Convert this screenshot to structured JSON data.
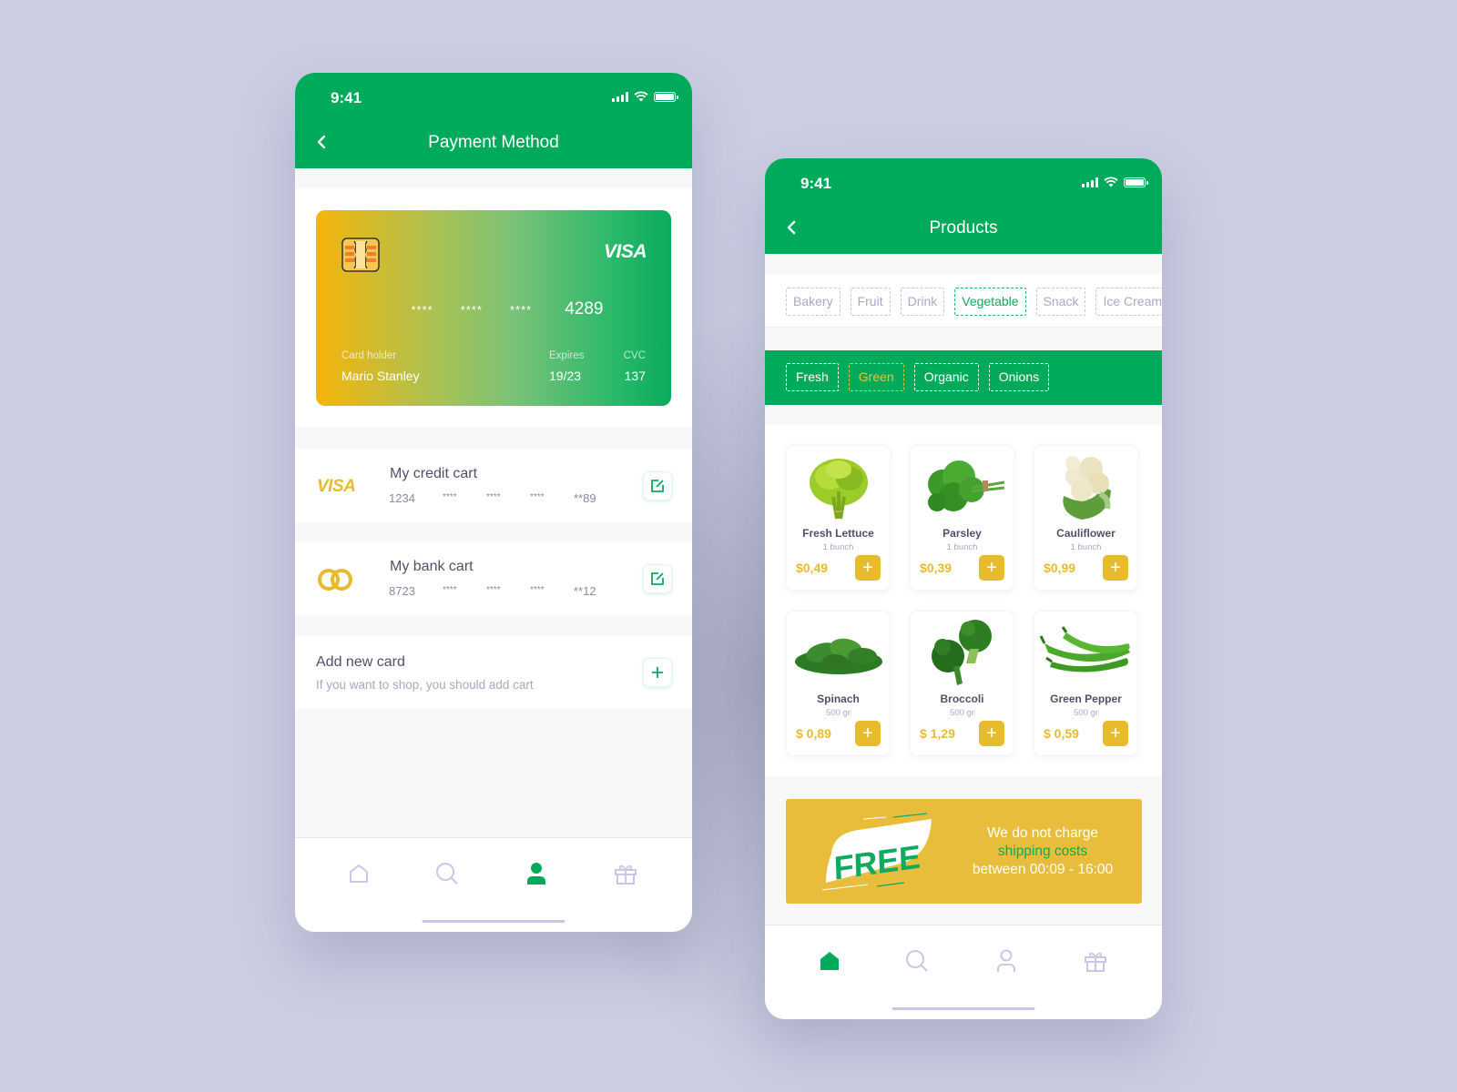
{
  "status_time": "9:41",
  "colors": {
    "brand_green": "#00aa5b",
    "accent_yellow": "#e8bb2f",
    "muted_text": "#a6a8c0",
    "inactive_icon": "#c8c8e6"
  },
  "payment": {
    "title": "Payment Method",
    "back_icon": "chevron-left-icon",
    "card": {
      "brand": "VISA",
      "number_masked": [
        "****",
        "****",
        "****"
      ],
      "last4": "4289",
      "holder_label": "Card holder",
      "holder_name": "Mario Stanley",
      "expires_label": "Expires",
      "expires_value": "19/23",
      "cvc_label": "CVC",
      "cvc_value": "137"
    },
    "saved_cards": [
      {
        "logo": "VISA",
        "title": "My credit cart",
        "digits": [
          "1234",
          "****",
          "****",
          "****",
          "**89"
        ]
      },
      {
        "logo": "mastercard-rings-icon",
        "title": "My bank cart",
        "digits": [
          "8723",
          "****",
          "****",
          "****",
          "**12"
        ]
      }
    ],
    "add_card": {
      "title": "Add new card",
      "subtitle": "If you want to shop, you should add cart"
    },
    "tabbar": {
      "active": "profile",
      "items": [
        "home",
        "search",
        "profile",
        "gift"
      ]
    }
  },
  "products": {
    "title": "Products",
    "categories": [
      {
        "label": "Bakery",
        "active": false
      },
      {
        "label": "Fruit",
        "active": false
      },
      {
        "label": "Drink",
        "active": false
      },
      {
        "label": "Vegetable",
        "active": true
      },
      {
        "label": "Snack",
        "active": false
      },
      {
        "label": "Ice Cream",
        "active": false
      }
    ],
    "subcategories": [
      {
        "label": "Fresh",
        "active": false
      },
      {
        "label": "Green",
        "active": true
      },
      {
        "label": "Organic",
        "active": false
      },
      {
        "label": "Onions",
        "active": false
      }
    ],
    "items": [
      {
        "name": "Fresh Lettuce",
        "unit": "1 bunch",
        "price": "$0,49",
        "icon": "lettuce-image"
      },
      {
        "name": "Parsley",
        "unit": "1 bunch",
        "price": "$0,39",
        "icon": "parsley-image"
      },
      {
        "name": "Cauliflower",
        "unit": "1 bunch",
        "price": "$0,99",
        "icon": "cauliflower-image"
      },
      {
        "name": "Spinach",
        "unit": "500 gr",
        "price": "$ 0,89",
        "icon": "spinach-image"
      },
      {
        "name": "Broccoli",
        "unit": "500 gr",
        "price": "$ 1,29",
        "icon": "broccoli-image"
      },
      {
        "name": "Green Pepper",
        "unit": "500 gr",
        "price": "$ 0,59",
        "icon": "green-pepper-image"
      }
    ],
    "add_label": "+",
    "promo": {
      "badge": "FREE",
      "line1": "We do not charge",
      "line2": "shipping costs",
      "line3": "between 00:09 - 16:00"
    },
    "tabbar": {
      "active": "home",
      "items": [
        "home",
        "search",
        "profile",
        "gift"
      ]
    }
  }
}
